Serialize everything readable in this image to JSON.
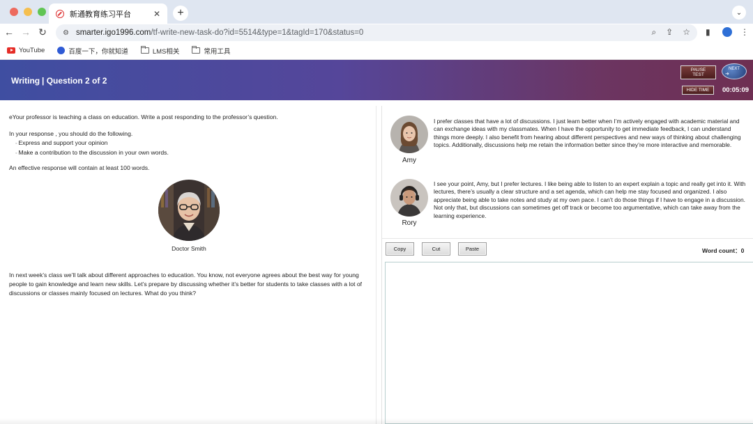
{
  "browser": {
    "tab": {
      "title": "新通教育练习平台",
      "close": "✕"
    },
    "new_tab": "+",
    "tab_menu": "⌄",
    "nav": {
      "back": "←",
      "forward": "→",
      "reload": "↻"
    },
    "url": {
      "host": "smarter.igo1996.com",
      "path": "/tf-write-new-task-do?id=5514&type=1&tagId=170&status=0"
    },
    "omni_icons": {
      "zoom": "⌕",
      "share": "⇪",
      "star": "☆"
    },
    "toolbar_icons": {
      "sidebar": "▮",
      "menu": "⋮"
    },
    "bookmarks": [
      {
        "label": "YouTube",
        "icon": "youtube-icon"
      },
      {
        "label": "百度一下，你就知道",
        "icon": "baidu-paw-icon"
      },
      {
        "label": "LMS相关",
        "icon": "folder-icon"
      },
      {
        "label": "常用工具",
        "icon": "folder-icon"
      }
    ]
  },
  "header": {
    "section": "Writing",
    "question": "| Question 2 of 2",
    "pause_line1": "PAUSE",
    "pause_line2": "TEST",
    "next": "NEXT",
    "next_arrow": "➜",
    "hide_time": "HIDE TIME",
    "timer": "00:05:09"
  },
  "prompt": {
    "intro": "eYour professor is teaching a class on education. Write a post responding to the professor’s question.",
    "todo": "In your response , you should do the following.",
    "list": [
      "Express and support your opinion",
      "Make a contribution to the discussion in your own words."
    ],
    "requirement": "An effective response will contain at least 100 words.",
    "professor_name": "Doctor Smith",
    "professor_question": "In next week’s class we’ll talk about different approaches to education. You know, not everyone agrees about the best way for young people to gain knowledge and learn new skills. Let’s prepare by discussing whether it’s better for students to take classes with a lot of discussions or classes mainly focused on lectures. What do you think?"
  },
  "posts": [
    {
      "name": "Amy",
      "text": "I prefer classes that have a lot of discussions. I just learn better when I’m actively engaged with academic material and can exchange ideas with my classmates. When I have the opportunity to get immediate feedback, I can understand things more deeply. I also benefit from hearing about different perspectives and new ways of thinking about challenging topics. Additionally, discussions help me retain the information better since they’re more interactive and memorable."
    },
    {
      "name": "Rory",
      "text": "I see your point, Amy, but I prefer lectures. I like being able to listen to an expert explain a topic and really get into it. With lectures, there’s usually a clear structure and a set agenda, which can help me stay focused and organized. I also appreciate being able to take notes and study at my own pace. I can’t do those things if I have to engage in a discussion. Not only that, but discussions can sometimes get off track or become too argumentative, which can take away from the learning experience."
    }
  ],
  "editor": {
    "copy": "Copy",
    "cut": "Cut",
    "paste": "Paste",
    "word_count_label": "Word count：",
    "word_count": "0",
    "value": ""
  }
}
